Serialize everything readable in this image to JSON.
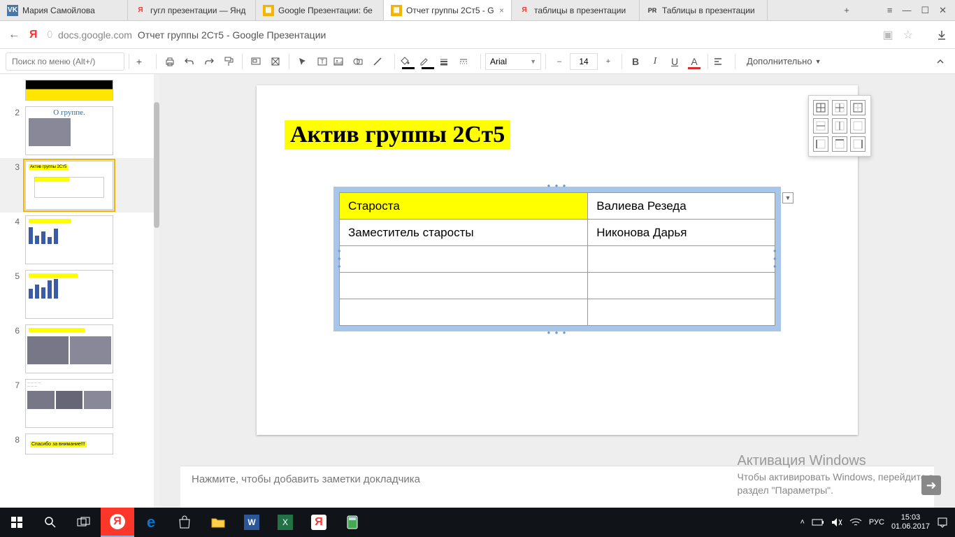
{
  "browser": {
    "tabs": [
      {
        "icon": "VK",
        "iconbg": "#4a76a8",
        "label": "Мария Самойлова"
      },
      {
        "icon": "Я",
        "iconbg": "#fff",
        "iconcolor": "#f33",
        "label": "гугл презентации — Янд"
      },
      {
        "icon": "▦",
        "iconbg": "#f4b400",
        "label": "Google Презентации: бе"
      },
      {
        "icon": "▦",
        "iconbg": "#f4b400",
        "label": "Отчет группы 2Ст5 - G",
        "close": "×",
        "active": true
      },
      {
        "icon": "Я",
        "iconbg": "#fff",
        "iconcolor": "#f33",
        "label": "таблицы в презентации"
      },
      {
        "icon": "PR",
        "iconbg": "#fff",
        "iconcolor": "#333",
        "label": "Таблицы в презентации"
      }
    ],
    "controls": {
      "menu": "≡",
      "min": "—",
      "max": "☐",
      "close": "✕",
      "newtab": "+"
    },
    "addr": {
      "back": "←",
      "ya": "Я",
      "lock": "🔒",
      "domain": "docs.google.com",
      "title": "Отчет группы 2Ст5 - Google Презентации",
      "star": "☆",
      "dl": "⤓"
    }
  },
  "toolbar": {
    "search_placeholder": "Поиск по меню (Alt+/)",
    "font": "Arial",
    "fontsize": "14",
    "more": "Дополнительно"
  },
  "thumbs": [
    {
      "n": "",
      "kind": "title"
    },
    {
      "n": "2",
      "kind": "about",
      "title": "О группе."
    },
    {
      "n": "3",
      "kind": "current",
      "title": "Актив группы 2Ст5"
    },
    {
      "n": "4",
      "kind": "chart"
    },
    {
      "n": "5",
      "kind": "chart"
    },
    {
      "n": "6",
      "kind": "photos"
    },
    {
      "n": "7",
      "kind": "photos2"
    },
    {
      "n": "8",
      "kind": "thanks",
      "title": "Спасибо за внимание!!!"
    }
  ],
  "slide": {
    "title": "Актив группы 2Ст5",
    "table": [
      [
        "Староста",
        "Валиева Резеда"
      ],
      [
        "Заместитель старосты",
        "Никонова Дарья"
      ],
      [
        "",
        ""
      ],
      [
        "",
        ""
      ],
      [
        "",
        ""
      ]
    ]
  },
  "notes_placeholder": "Нажмите, чтобы добавить заметки докладчика",
  "watermark": {
    "title": "Активация Windows",
    "line1": "Чтобы активировать Windows, перейдите в",
    "line2": "раздел \"Параметры\"."
  },
  "tray": {
    "lang": "РУС",
    "time": "15:03",
    "date": "01.06.2017"
  }
}
